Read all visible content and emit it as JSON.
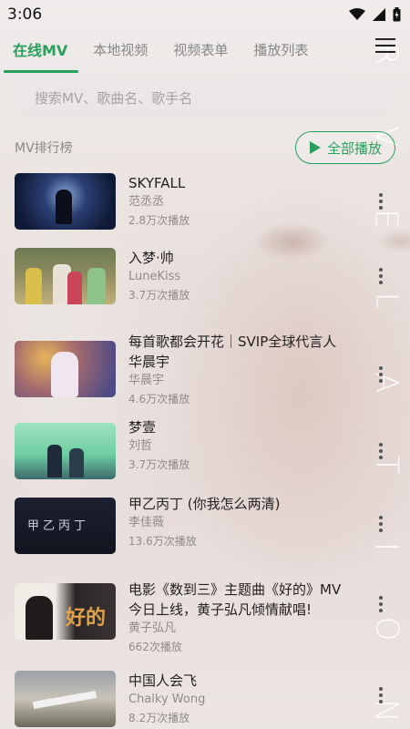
{
  "status": {
    "time": "3:06"
  },
  "tabs": [
    {
      "label": "在线MV"
    },
    {
      "label": "本地视频"
    },
    {
      "label": "视频表单"
    },
    {
      "label": "播放列表"
    }
  ],
  "search": {
    "placeholder": "搜索MV、歌曲名、歌手名"
  },
  "section": {
    "title": "MV排行榜",
    "play_all": "全部播放"
  },
  "items": [
    {
      "title": "SKYFALL",
      "artist": "范丞丞",
      "plays": "2.8万次播放"
    },
    {
      "title": "入梦·帅",
      "artist": "LuneKiss",
      "plays": "3.7万次播放"
    },
    {
      "title": "每首歌都会开花｜SVIP全球代言人华晨宇",
      "artist": "华晨宇",
      "plays": "4.6万次播放"
    },
    {
      "title": "梦壹",
      "artist": "刘哲",
      "plays": "3.7万次播放"
    },
    {
      "title": "甲乙丙丁 (你我怎么两清)",
      "artist": "李佳薇",
      "plays": "13.6万次播放"
    },
    {
      "title": "电影《数到三》主题曲《好的》MV今日上线，黄子弘凡倾情献唱!",
      "artist": "黄子弘凡",
      "plays": "662次播放"
    },
    {
      "title": "中国人会飞",
      "artist": "Chalky Wong",
      "plays": "8.2万次播放"
    }
  ],
  "thumb_text": {
    "item5": "甲乙丙丁",
    "item6": "好的"
  },
  "colors": {
    "accent": "#2aa05e"
  }
}
